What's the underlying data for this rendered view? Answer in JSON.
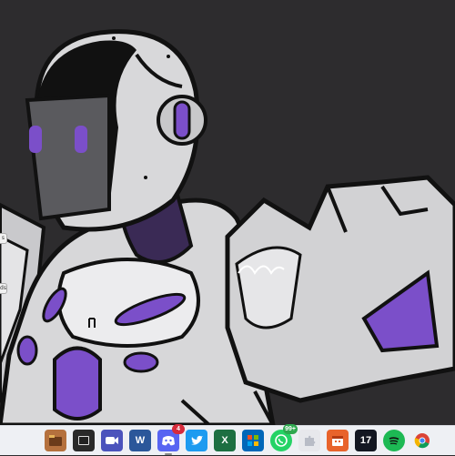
{
  "desktop": {
    "wallpaper": "robot-knight-wallpaper",
    "background_color": "#2d2c2e",
    "armor_color": "#d4d4d6",
    "accent_color": "#7b4fc9",
    "edge_tabs": [
      {
        "label": "s"
      },
      {
        "label": "ds"
      }
    ]
  },
  "taskbar": {
    "background_color": "#eef0f4",
    "apps": [
      {
        "name": "file-explorer-icon",
        "label": "",
        "badge": ""
      },
      {
        "name": "terminal-icon",
        "label": "",
        "badge": ""
      },
      {
        "name": "video-call-icon",
        "label": "",
        "badge": ""
      },
      {
        "name": "word-icon",
        "label": "W",
        "badge": ""
      },
      {
        "name": "discord-icon",
        "label": "",
        "badge": "4"
      },
      {
        "name": "twitter-icon",
        "label": "",
        "badge": ""
      },
      {
        "name": "excel-icon",
        "label": "X",
        "badge": ""
      },
      {
        "name": "store-icon",
        "label": "",
        "badge": ""
      },
      {
        "name": "whatsapp-icon",
        "label": "",
        "badge": "99+"
      },
      {
        "name": "puzzle-icon",
        "label": "",
        "badge": ""
      },
      {
        "name": "calendar-icon",
        "label": "",
        "badge": ""
      },
      {
        "name": "tradingview-icon",
        "label": "17",
        "badge": ""
      },
      {
        "name": "spotify-icon",
        "label": "",
        "badge": ""
      },
      {
        "name": "chrome-icon",
        "label": "",
        "badge": ""
      }
    ]
  }
}
